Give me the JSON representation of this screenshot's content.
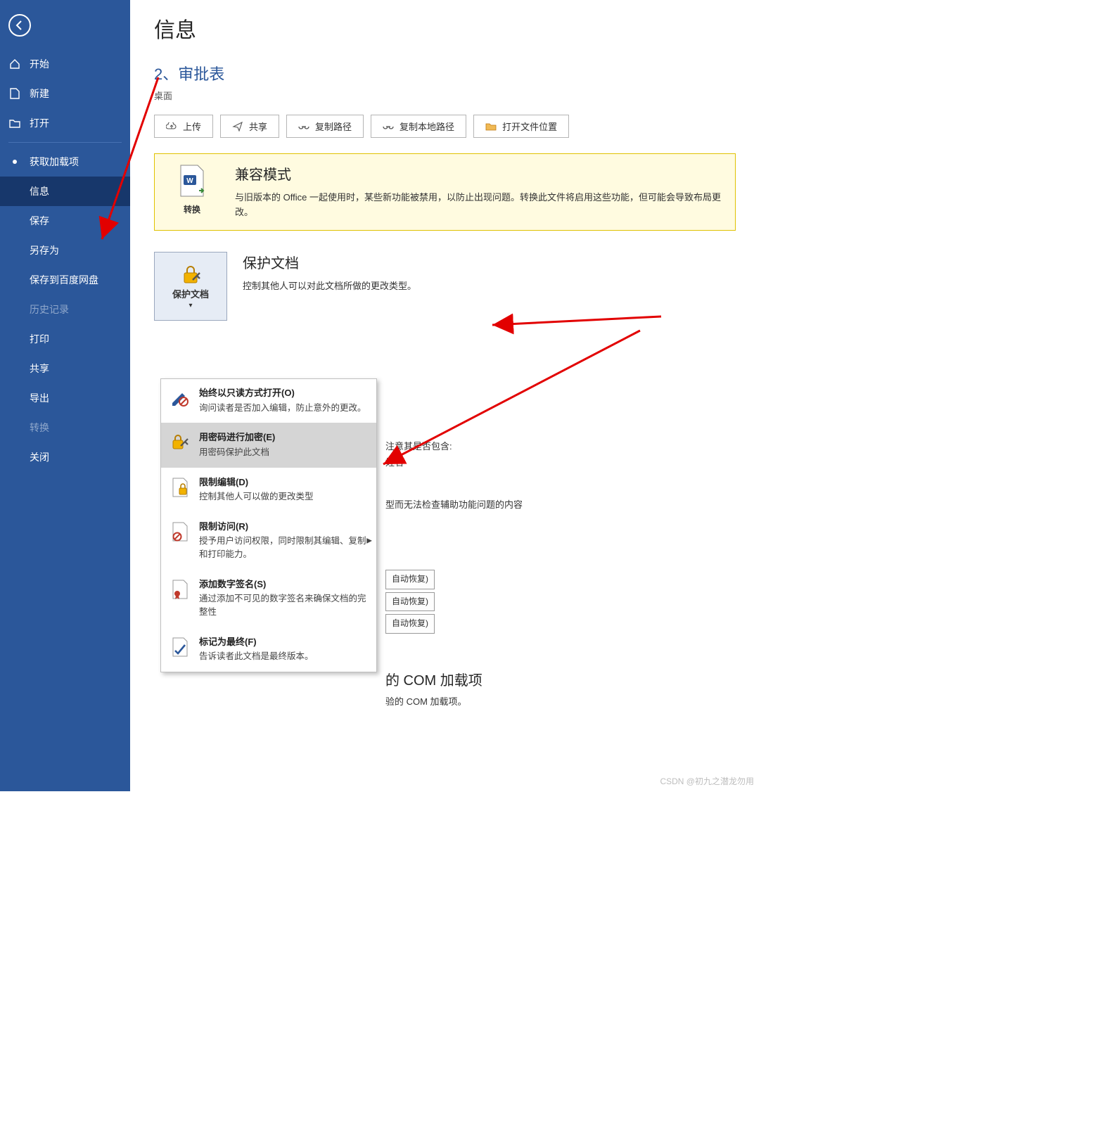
{
  "sidebar": {
    "back_label": "返回",
    "items": [
      {
        "label": "开始",
        "icon": "home-icon"
      },
      {
        "label": "新建",
        "icon": "new-icon"
      },
      {
        "label": "打开",
        "icon": "open-icon"
      }
    ],
    "addins_label": "获取加载项",
    "secondary": [
      {
        "key": "info",
        "label": "信息",
        "selected": true
      },
      {
        "key": "save",
        "label": "保存"
      },
      {
        "key": "saveas",
        "label": "另存为"
      },
      {
        "key": "baidu",
        "label": "保存到百度网盘"
      },
      {
        "key": "history",
        "label": "历史记录",
        "disabled": true
      },
      {
        "key": "print",
        "label": "打印"
      },
      {
        "key": "share",
        "label": "共享"
      },
      {
        "key": "export",
        "label": "导出"
      },
      {
        "key": "convert",
        "label": "转换",
        "disabled": true
      },
      {
        "key": "close",
        "label": "关闭"
      }
    ]
  },
  "page": {
    "title": "信息",
    "doc_title": "2、审批表",
    "doc_path": "桌面"
  },
  "actions": {
    "upload": "上传",
    "share": "共享",
    "copy_path": "复制路径",
    "copy_local_path": "复制本地路径",
    "open_location": "打开文件位置"
  },
  "compat": {
    "tile_label": "转换",
    "heading": "兼容模式",
    "body": "与旧版本的 Office 一起使用时，某些新功能被禁用，以防止出现问题。转换此文件将启用这些功能，但可能会导致布局更改。"
  },
  "protect": {
    "tile_label": "保护文档",
    "heading": "保护文档",
    "body": "控制其他人可以对此文档所做的更改类型。"
  },
  "dropdown": [
    {
      "key": "readonly",
      "title": "始终以只读方式打开(O)",
      "desc": "询问读者是否加入编辑，防止意外的更改。",
      "highlight": false
    },
    {
      "key": "encrypt",
      "title": "用密码进行加密(E)",
      "desc": "用密码保护此文档",
      "highlight": true
    },
    {
      "key": "restrict",
      "title": "限制编辑(D)",
      "desc": "控制其他人可以做的更改类型",
      "highlight": false
    },
    {
      "key": "access",
      "title": "限制访问(R)",
      "desc": "授予用户访问权限，同时限制其编辑、复制和打印能力。",
      "highlight": false,
      "submenu": true
    },
    {
      "key": "sign",
      "title": "添加数字签名(S)",
      "desc": "通过添加不可见的数字签名来确保文档的完整性",
      "highlight": false
    },
    {
      "key": "final",
      "title": "标记为最终(F)",
      "desc": "告诉读者此文档是最终版本。",
      "highlight": false
    }
  ],
  "behind": {
    "check_line1": "注意其是否包含:",
    "check_line2": "姓名",
    "accessibility_text": "型而无法检查辅助功能问题的内容",
    "auto_recover": "自动恢复)",
    "com_heading": "的 COM 加载项",
    "com_text": "验的 COM 加载项。"
  },
  "watermark": "CSDN @初九之潜龙勿用"
}
